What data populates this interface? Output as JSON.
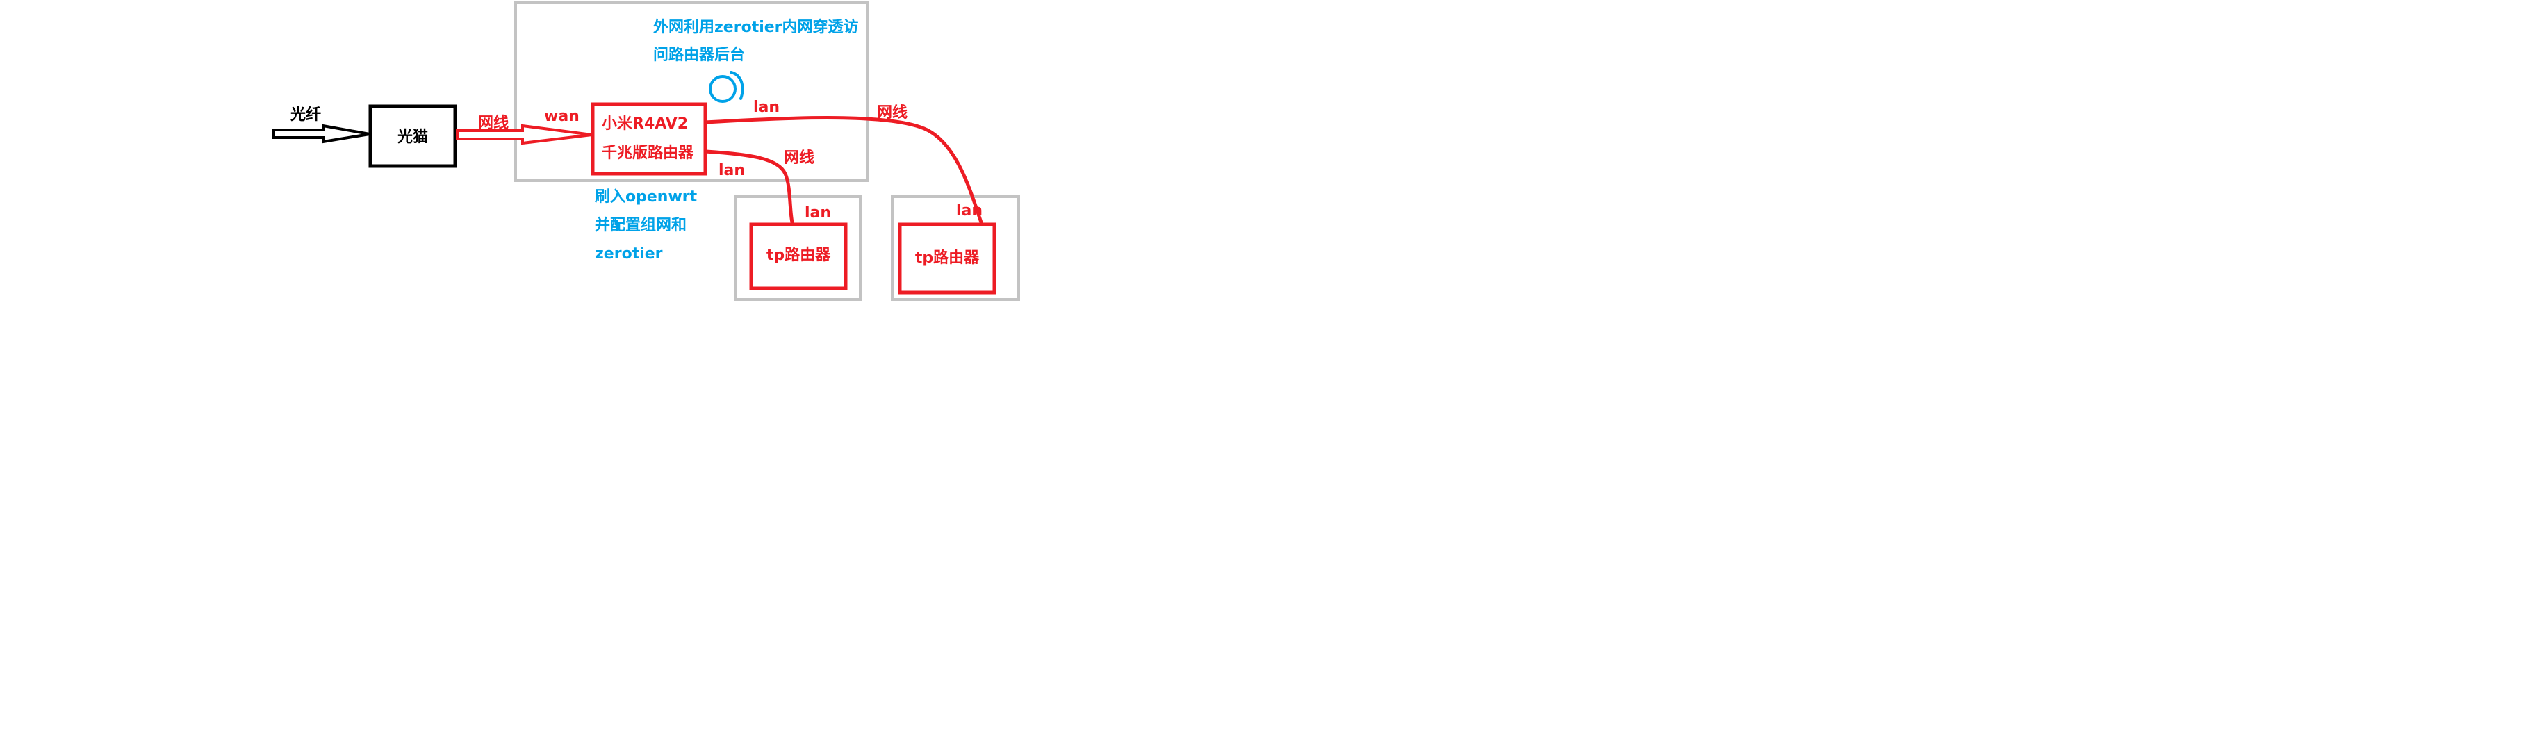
{
  "colors": {
    "red": "#ed1c24",
    "blue": "#00a2e8",
    "gray": "#c3c3c3",
    "black": "#000000",
    "background": "#ffffff"
  },
  "labels": {
    "fiber": "光纤",
    "optical_modem": "光猫",
    "cable_1": "网线",
    "wan": "wan",
    "main_router_line1": "小米R4AV2",
    "main_router_line2": "千兆版路由器",
    "lan_top": "lan",
    "cable_top": "网线",
    "lan_mid": "lan",
    "cable_mid": "网线",
    "lan_tp1": "lan",
    "lan_tp2": "lan",
    "tp_router_1": "tp路由器",
    "tp_router_2": "tp路由器",
    "note_zerotier_line1": "外网利用zerotier内网穿透访",
    "note_zerotier_line2": "问路由器后台",
    "note_flash_line1": "刷入openwrt",
    "note_flash_line2": "并配置组网和",
    "note_flash_line3": "zerotier"
  },
  "icons": {
    "refresh": "circular-arrow-icon"
  }
}
